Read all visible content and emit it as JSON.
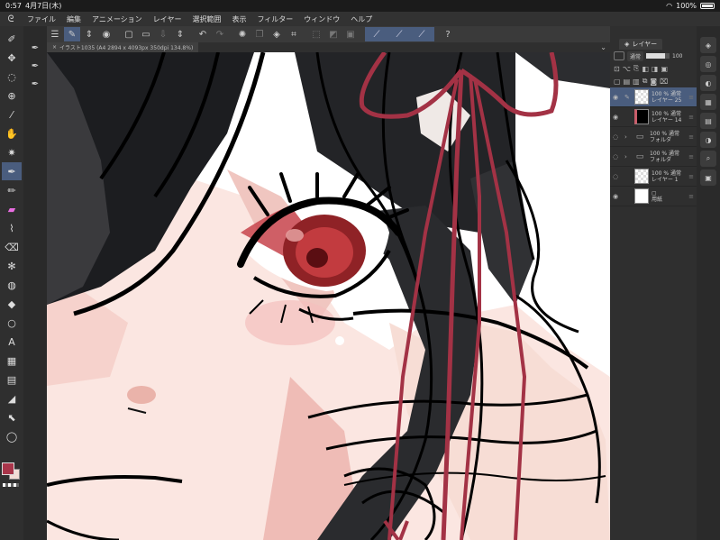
{
  "status": {
    "time": "0:57",
    "date": "4月7日(木)",
    "battery": "100%",
    "wifi_icon": "wifi-icon"
  },
  "menu": [
    "ファイル",
    "編集",
    "アニメーション",
    "レイヤー",
    "選択範囲",
    "表示",
    "フィルター",
    "ウィンドウ",
    "ヘルプ"
  ],
  "document": {
    "tab_label": "イラスト1035 (A4 2894 x 4093px 350dpi 134.8%)"
  },
  "layers_panel": {
    "tab_label": "レイヤー",
    "blend_mode": "通常",
    "opacity": "100",
    "layers": [
      {
        "opacity": "100 %",
        "mode": "通常",
        "name": "レイヤー 25",
        "thumb": "check",
        "selected": true,
        "kind": "raster"
      },
      {
        "opacity": "100 %",
        "mode": "通常",
        "name": "レイヤー 14",
        "thumb": "black",
        "selected": false,
        "kind": "raster"
      },
      {
        "opacity": "100 %",
        "mode": "通常",
        "name": "フォルダ",
        "thumb": "folder",
        "selected": false,
        "kind": "folder"
      },
      {
        "opacity": "100 %",
        "mode": "通常",
        "name": "フォルダ",
        "thumb": "folder",
        "selected": false,
        "kind": "folder"
      },
      {
        "opacity": "100 %",
        "mode": "通常",
        "name": "レイヤー 1",
        "thumb": "check",
        "selected": false,
        "kind": "raster"
      },
      {
        "opacity": "",
        "mode": "",
        "name": "用紙",
        "thumb": "white",
        "selected": false,
        "kind": "paper"
      }
    ]
  },
  "colors": {
    "main": "#a9354a",
    "sub": "#f3ddd6",
    "accent": "#4a5d7e"
  }
}
